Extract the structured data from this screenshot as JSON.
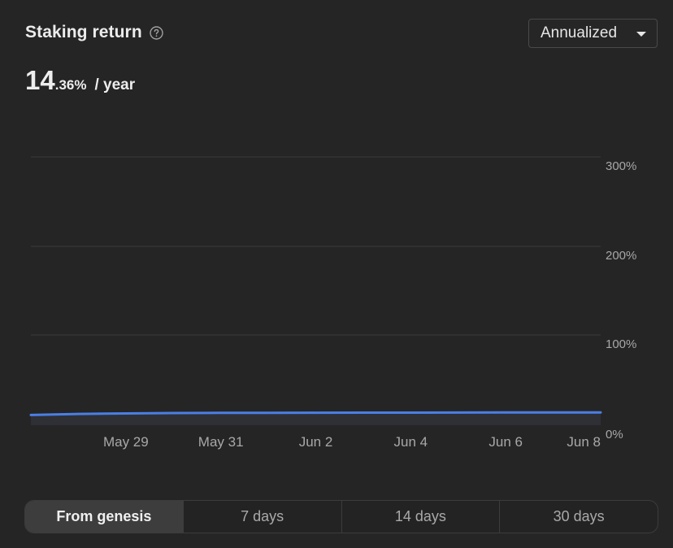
{
  "header": {
    "title": "Staking return",
    "help_icon": "question-circle-icon"
  },
  "dropdown": {
    "selected": "Annualized",
    "icon": "caret-down-icon"
  },
  "rate": {
    "integer": "14",
    "decimal": ".36%",
    "unit": "/ year"
  },
  "tabs": [
    {
      "label": "From genesis",
      "active": true
    },
    {
      "label": "7 days",
      "active": false
    },
    {
      "label": "14 days",
      "active": false
    },
    {
      "label": "30 days",
      "active": false
    }
  ],
  "colors": {
    "background": "#252525",
    "line": "#4a7fe6",
    "grid": "#3a3a3a",
    "axis_text": "#a8a8a8"
  },
  "chart_data": {
    "type": "line",
    "x_tick_labels": [
      "May 29",
      "May 31",
      "Jun 2",
      "Jun 4",
      "Jun 6",
      "Jun 8"
    ],
    "y_tick_labels": [
      "300%",
      "200%",
      "100%",
      "0%"
    ],
    "y_ticks": [
      300,
      200,
      100,
      0
    ],
    "ylim": [
      0,
      300
    ],
    "x_range_days": [
      -2,
      10
    ],
    "x_ticks_days": [
      0,
      2,
      4,
      6,
      8,
      10
    ],
    "grid": true,
    "y_axis_position": "right",
    "series": [
      {
        "x_days": [
          -2,
          -1,
          0,
          1,
          2,
          3,
          4,
          5,
          6,
          7,
          8,
          9,
          10
        ],
        "values": [
          11.5,
          12.6,
          13.2,
          13.6,
          13.8,
          13.9,
          14.0,
          14.1,
          14.1,
          14.2,
          14.3,
          14.3,
          14.4
        ]
      }
    ]
  }
}
